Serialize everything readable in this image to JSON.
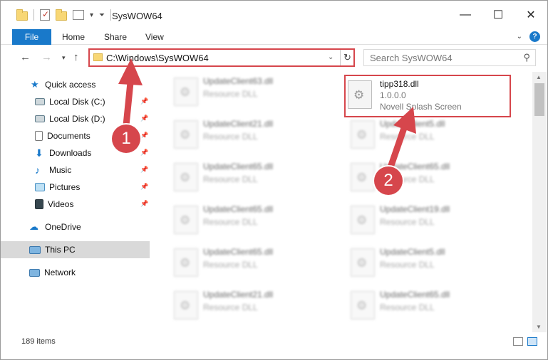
{
  "window": {
    "title": "SysWOW64",
    "minimize_glyph": "—",
    "maximize_glyph": "☐",
    "close_glyph": "✕"
  },
  "ribbon": {
    "tabs": [
      "File",
      "Home",
      "Share",
      "View"
    ],
    "accent": "#1979ca"
  },
  "nav": {
    "address": "C:\\Windows\\SysWOW64",
    "search_placeholder": "Search SysWOW64"
  },
  "sidebar": {
    "items": [
      {
        "label": "Quick access",
        "icon": "star-icon",
        "pinned": false
      },
      {
        "label": "Local Disk (C:)",
        "icon": "drive-icon",
        "pinned": true
      },
      {
        "label": "Local Disk (D:)",
        "icon": "drive-icon",
        "pinned": true
      },
      {
        "label": "Documents",
        "icon": "documents-icon",
        "pinned": true
      },
      {
        "label": "Downloads",
        "icon": "download-icon",
        "pinned": true
      },
      {
        "label": "Music",
        "icon": "music-icon",
        "pinned": true
      },
      {
        "label": "Pictures",
        "icon": "pictures-icon",
        "pinned": true
      },
      {
        "label": "Videos",
        "icon": "videos-icon",
        "pinned": true
      },
      {
        "label": "OneDrive",
        "icon": "cloud-icon",
        "pinned": false
      },
      {
        "label": "This PC",
        "icon": "computer-icon",
        "pinned": false,
        "selected": true
      },
      {
        "label": "Network",
        "icon": "network-icon",
        "pinned": false
      }
    ]
  },
  "files": {
    "left": [
      {
        "name": "UpdateClient63.dll",
        "desc": "Resource DLL"
      },
      {
        "name": "UpdateClient21.dll",
        "desc": "Resource DLL"
      },
      {
        "name": "UpdateClient65.dll",
        "desc": "Resource DLL"
      },
      {
        "name": "UpdateClient65.dll",
        "desc": "Resource DLL"
      },
      {
        "name": "UpdateClient65.dll",
        "desc": "Resource DLL"
      },
      {
        "name": "UpdateClient21.dll",
        "desc": "Resource DLL"
      }
    ],
    "right": [
      {
        "name": "tipp318.dll",
        "version": "1.0.0.0",
        "desc": "Novell Splash Screen"
      },
      {
        "name": "UpdateClient5.dll",
        "desc": "Resource DLL"
      },
      {
        "name": "UpdateClient65.dll",
        "desc": "Resource DLL"
      },
      {
        "name": "UpdateClient19.dll",
        "desc": "Resource DLL"
      },
      {
        "name": "UpdateClient5.dll",
        "desc": "Resource DLL"
      },
      {
        "name": "UpdateClient65.dll",
        "desc": "Resource DLL"
      }
    ]
  },
  "status": {
    "item_count": "189 items"
  },
  "annotations": {
    "badge1": "1",
    "badge2": "2",
    "color": "#d6464c"
  }
}
